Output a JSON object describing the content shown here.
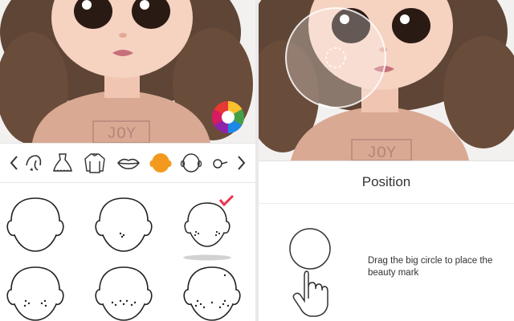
{
  "left_screen": {
    "toolbar": {
      "items": [
        {
          "icon": "chevron-left-icon"
        },
        {
          "icon": "hair-icon"
        },
        {
          "icon": "dress-icon"
        },
        {
          "icon": "sweater-icon"
        },
        {
          "icon": "lips-icon"
        },
        {
          "icon": "face-skin-icon",
          "selected": true
        },
        {
          "icon": "head-shape-icon"
        },
        {
          "icon": "glasses-icon"
        },
        {
          "icon": "chevron-right-icon"
        }
      ]
    },
    "shirt_text": "JOY",
    "face_options": [
      {
        "freckles": "none",
        "selected": false
      },
      {
        "freckles": "few",
        "selected": false
      },
      {
        "freckles": "cheeks",
        "selected": true
      },
      {
        "freckles": "chin",
        "selected": false
      },
      {
        "freckles": "center",
        "selected": false
      },
      {
        "freckles": "many",
        "selected": false
      }
    ]
  },
  "right_screen": {
    "shirt_text": "JOY",
    "header": {
      "title": "Position"
    },
    "instruction": "Drag the big circle to place the beauty mark"
  },
  "colors": {
    "accent": "#f39a1e",
    "check": "#e8384f",
    "text": "#333333"
  }
}
